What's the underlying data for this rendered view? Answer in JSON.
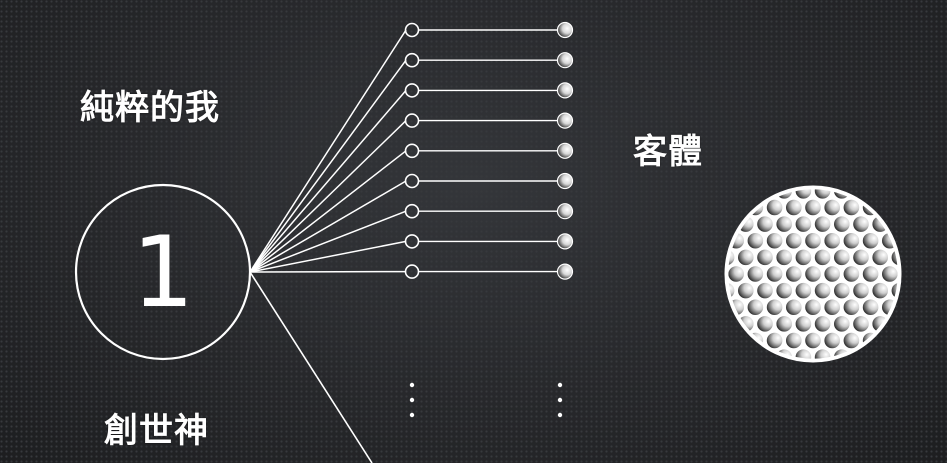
{
  "labels": {
    "pure_self": "純粹的我",
    "creator": "創世神",
    "object": "客體",
    "one": "1"
  },
  "chains": {
    "count": 9,
    "has_more": true
  },
  "colors": {
    "background": "#2b2c2f",
    "stroke": "#ffffff",
    "text": "#ffffff"
  }
}
